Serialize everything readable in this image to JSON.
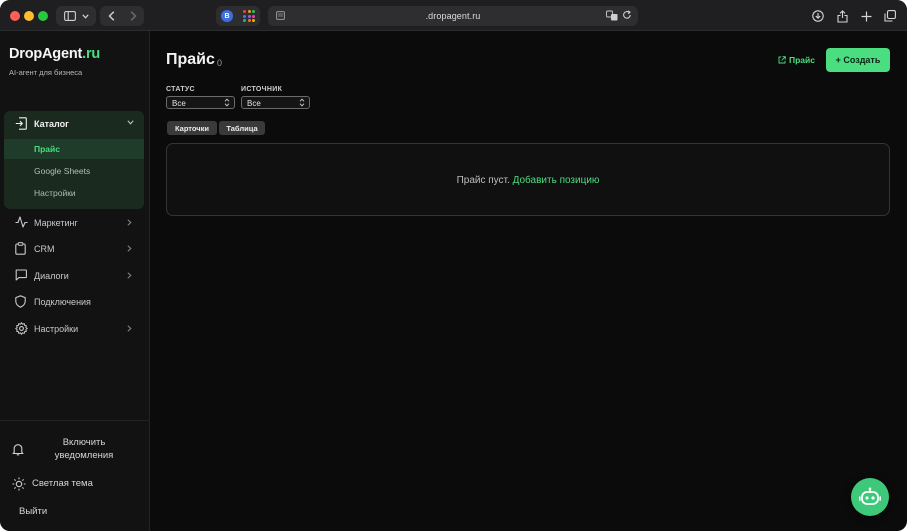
{
  "browser": {
    "url": ".dropagent.ru",
    "extension_badge": "B"
  },
  "brand": {
    "name": "DropAgent",
    "suffix": ".ru",
    "tagline": "AI-агент для бизнеса"
  },
  "sidebar": {
    "catalog": {
      "label": "Каталог",
      "items": [
        {
          "label": "Прайс",
          "active": true
        },
        {
          "label": "Google Sheets",
          "active": false
        },
        {
          "label": "Настройки",
          "active": false
        }
      ]
    },
    "items": [
      {
        "label": "Маркетинг",
        "icon": "activity-icon",
        "has_submenu": true
      },
      {
        "label": "CRM",
        "icon": "clipboard-icon",
        "has_submenu": true
      },
      {
        "label": "Диалоги",
        "icon": "chat-icon",
        "has_submenu": true
      },
      {
        "label": "Подключения",
        "icon": "shield-icon",
        "has_submenu": false
      },
      {
        "label": "Настройки",
        "icon": "gear-icon",
        "has_submenu": true
      }
    ],
    "bottom": {
      "notifications_line1": "Включить",
      "notifications_line2": "уведомления",
      "theme": "Светлая тема",
      "logout": "Выйти"
    }
  },
  "page": {
    "title": "Прайс",
    "count": "0",
    "price_link": "Прайс",
    "create_button": "+ Создать"
  },
  "filters": {
    "status": {
      "label": "СТАТУС",
      "value": "Все"
    },
    "source": {
      "label": "ИСТОЧНИК",
      "value": "Все"
    }
  },
  "views": {
    "cards": "Карточки",
    "table": "Таблица"
  },
  "empty": {
    "text": "Прайс пуст.",
    "action": "Добавить позицию"
  },
  "colors": {
    "accent": "#4ade80",
    "background": "#0b0b0b",
    "sidebar": "#121212"
  }
}
